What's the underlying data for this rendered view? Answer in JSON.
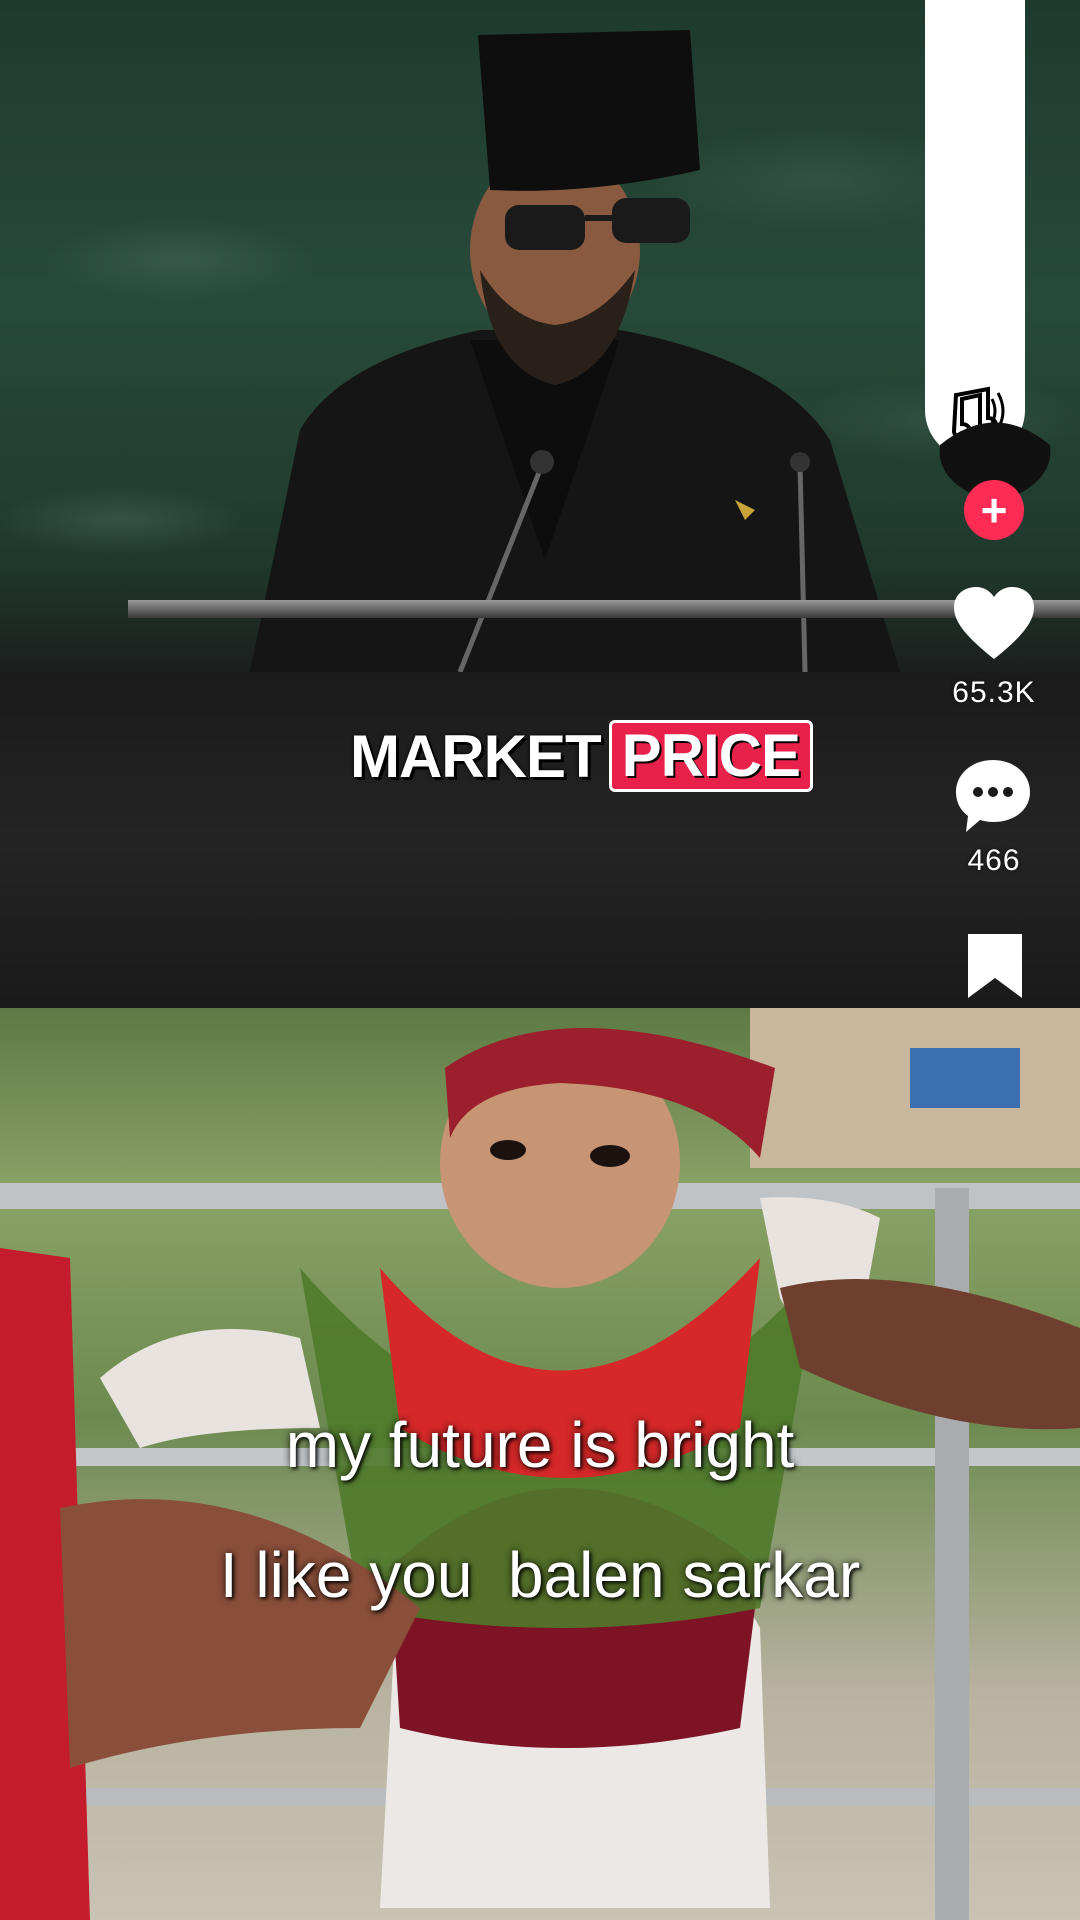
{
  "video": {
    "overlay_title_part1": "MARKET",
    "overlay_title_part2": "PRICE",
    "caption_line1": "my future is bright",
    "caption_line2": "I like you  balen sarkar"
  },
  "actions": {
    "likes": "65.3K",
    "comments": "466",
    "follow_symbol": "+"
  },
  "colors": {
    "accent": "#fe2c55",
    "price_badge": "#e8214b"
  },
  "icons": [
    "music-note-icon",
    "plus-icon",
    "heart-icon",
    "comment-bubble-icon",
    "bookmark-icon"
  ]
}
